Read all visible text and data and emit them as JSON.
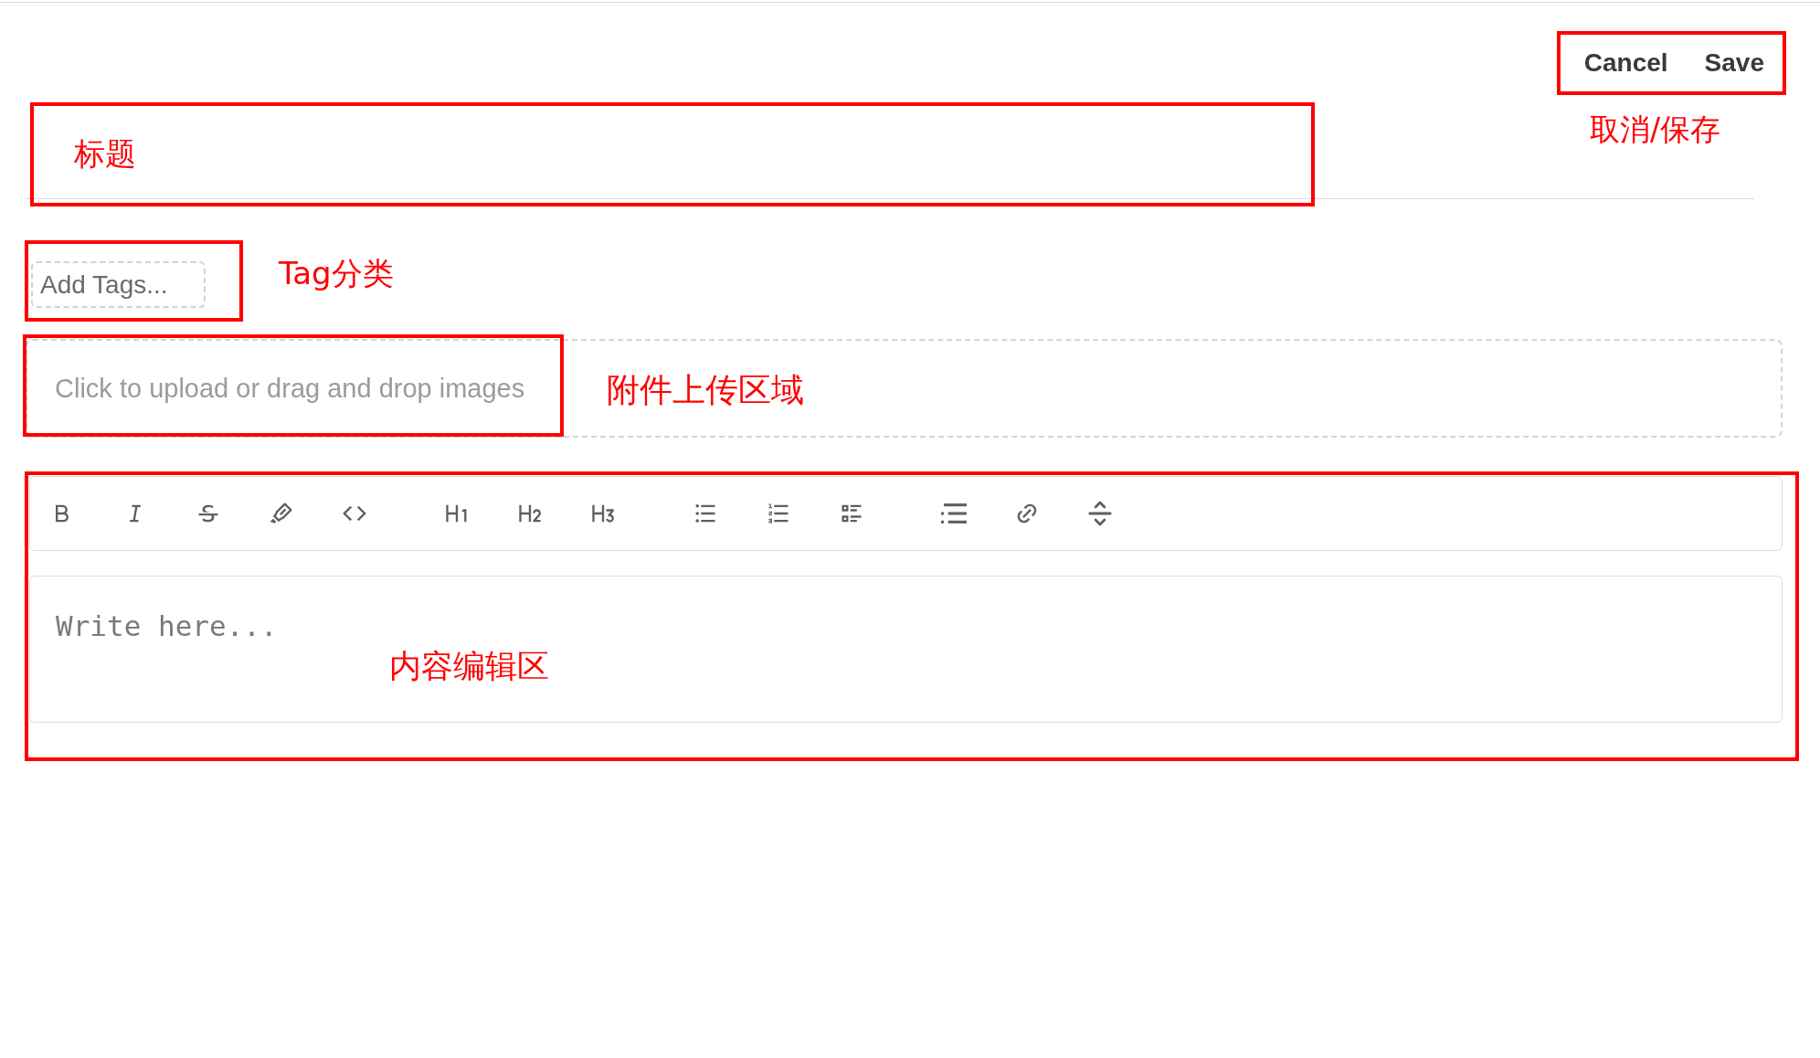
{
  "header": {
    "actions": [
      "Cancel",
      "Save"
    ]
  },
  "tags_field": {
    "placeholder": "Add Tags..."
  },
  "upload_area": {
    "prompt": "Click to upload or drag and drop images"
  },
  "editor": {
    "toolbar": [
      {
        "tools": [
          {
            "kind": "bold"
          },
          {
            "kind": "italic"
          },
          {
            "kind": "strike"
          },
          {
            "kind": "highlight"
          },
          {
            "kind": "code"
          }
        ]
      },
      {
        "tools": [
          {
            "kind": "h1"
          },
          {
            "kind": "h2"
          },
          {
            "kind": "h3"
          }
        ]
      },
      {
        "tools": [
          {
            "kind": "bullet_list"
          },
          {
            "kind": "ordered_list"
          },
          {
            "kind": "task_list"
          }
        ]
      },
      {
        "tools": [
          {
            "kind": "list"
          },
          {
            "kind": "link"
          },
          {
            "kind": "rule"
          }
        ]
      }
    ],
    "placeholder": "Write here..."
  },
  "annotations": [
    {
      "label": "取消/保存"
    },
    {
      "label": "标题"
    },
    {
      "label": "Tag分类"
    },
    {
      "label": "附件上传区域"
    },
    {
      "label": "内容编辑区"
    }
  ]
}
